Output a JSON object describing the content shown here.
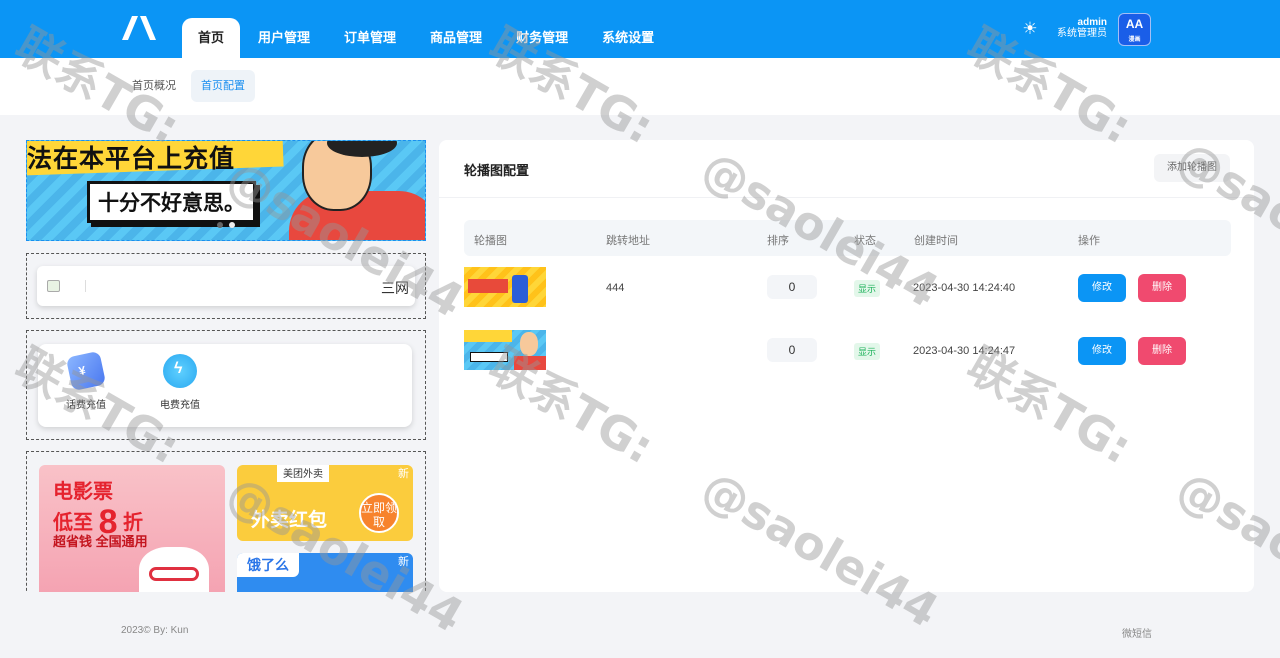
{
  "header": {
    "logo_icon": "brand-logo-icon",
    "nav": [
      {
        "label": "首页",
        "active": true
      },
      {
        "label": "用户管理",
        "active": false
      },
      {
        "label": "订单管理",
        "active": false
      },
      {
        "label": "商品管理",
        "active": false
      },
      {
        "label": "财务管理",
        "active": false
      },
      {
        "label": "系统设置",
        "active": false
      }
    ],
    "theme_icon": "sun-icon",
    "user_name": "admin",
    "user_role": "系统管理员",
    "avatar_text": "AA",
    "avatar_sub": "漫画"
  },
  "subnav": {
    "tabs": [
      {
        "label": "首页概况",
        "active": false
      },
      {
        "label": "首页配置",
        "active": true
      }
    ]
  },
  "preview": {
    "banner_line1": "法在本平台上充值",
    "banner_line2": "十分不好意思。",
    "notice_text": "三网",
    "icons": [
      {
        "label": "话费充值",
        "icon": "phone-bill-icon"
      },
      {
        "label": "电费充值",
        "icon": "lightning-icon"
      }
    ],
    "promo_movie_1": "电影票",
    "promo_movie_2": "低至",
    "promo_movie_num": "8",
    "promo_movie_unit": "折",
    "promo_movie_3": "超省钱 全国通用",
    "promo_meituan_tag": "美团外卖",
    "promo_meituan_main": "外卖红包",
    "promo_meituan_btn": "立即领取",
    "promo_new": "新",
    "promo_eleme_tag": "饿了么"
  },
  "carousel": {
    "title": "轮播图配置",
    "add_button": "添加轮播图",
    "columns": [
      "轮播图",
      "跳转地址",
      "排序",
      "状态",
      "创建时间",
      "操作"
    ],
    "rows": [
      {
        "link": "444",
        "sort": "0",
        "status": "显示",
        "created": "2023-04-30 14:24:40",
        "edit": "修改",
        "delete": "删除"
      },
      {
        "link": "",
        "sort": "0",
        "status": "显示",
        "created": "2023-04-30 14:24:47",
        "edit": "修改",
        "delete": "删除"
      }
    ]
  },
  "footer": {
    "left": "2023© By: Kun",
    "right": "微短信"
  },
  "watermarks": [
    "联系TG:",
    "@saolei44"
  ],
  "colors": {
    "primary": "#0b95f5",
    "danger": "#f04a6f",
    "success": "#1cb25a"
  }
}
